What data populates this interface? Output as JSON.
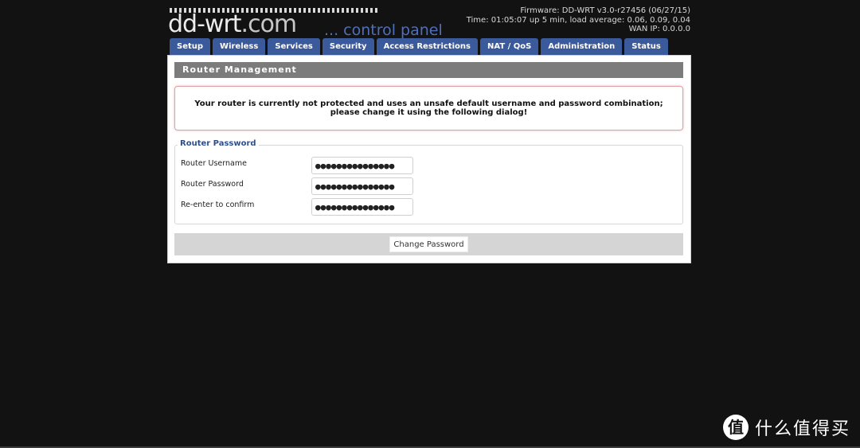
{
  "header": {
    "logo_text": "dd-wrt",
    "logo_dotcom": ".com",
    "logo_sub": "... control panel",
    "firmware": "Firmware: DD-WRT v3.0-r27456 (06/27/15)",
    "time": "Time: 01:05:07 up 5 min, load average: 0.06, 0.09, 0.04",
    "wan_ip": "WAN IP: 0.0.0.0"
  },
  "tabs": [
    {
      "label": "Setup"
    },
    {
      "label": "Wireless"
    },
    {
      "label": "Services"
    },
    {
      "label": "Security"
    },
    {
      "label": "Access Restrictions"
    },
    {
      "label": "NAT / QoS"
    },
    {
      "label": "Administration"
    },
    {
      "label": "Status"
    }
  ],
  "main": {
    "section_title": "Router Management",
    "warning": "Your router is currently not protected and uses an unsafe default username and password combination; please change it using the following dialog!",
    "fieldset_legend": "Router Password",
    "fields": [
      {
        "label": "Router Username",
        "value": "●●●●●●●●●●●●●●●"
      },
      {
        "label": "Router Password",
        "value": "●●●●●●●●●●●●●●●"
      },
      {
        "label": "Re-enter to confirm",
        "value": "●●●●●●●●●●●●●●●"
      }
    ],
    "change_button": "Change Password"
  },
  "watermark": {
    "logo": "值",
    "text": "什么值得买"
  },
  "colors": {
    "background": "#121212",
    "tab": "#3a5a9c",
    "section_bar": "#7c7c7c",
    "legend": "#2e4f8f",
    "logo_sub": "#4f6fb8"
  }
}
